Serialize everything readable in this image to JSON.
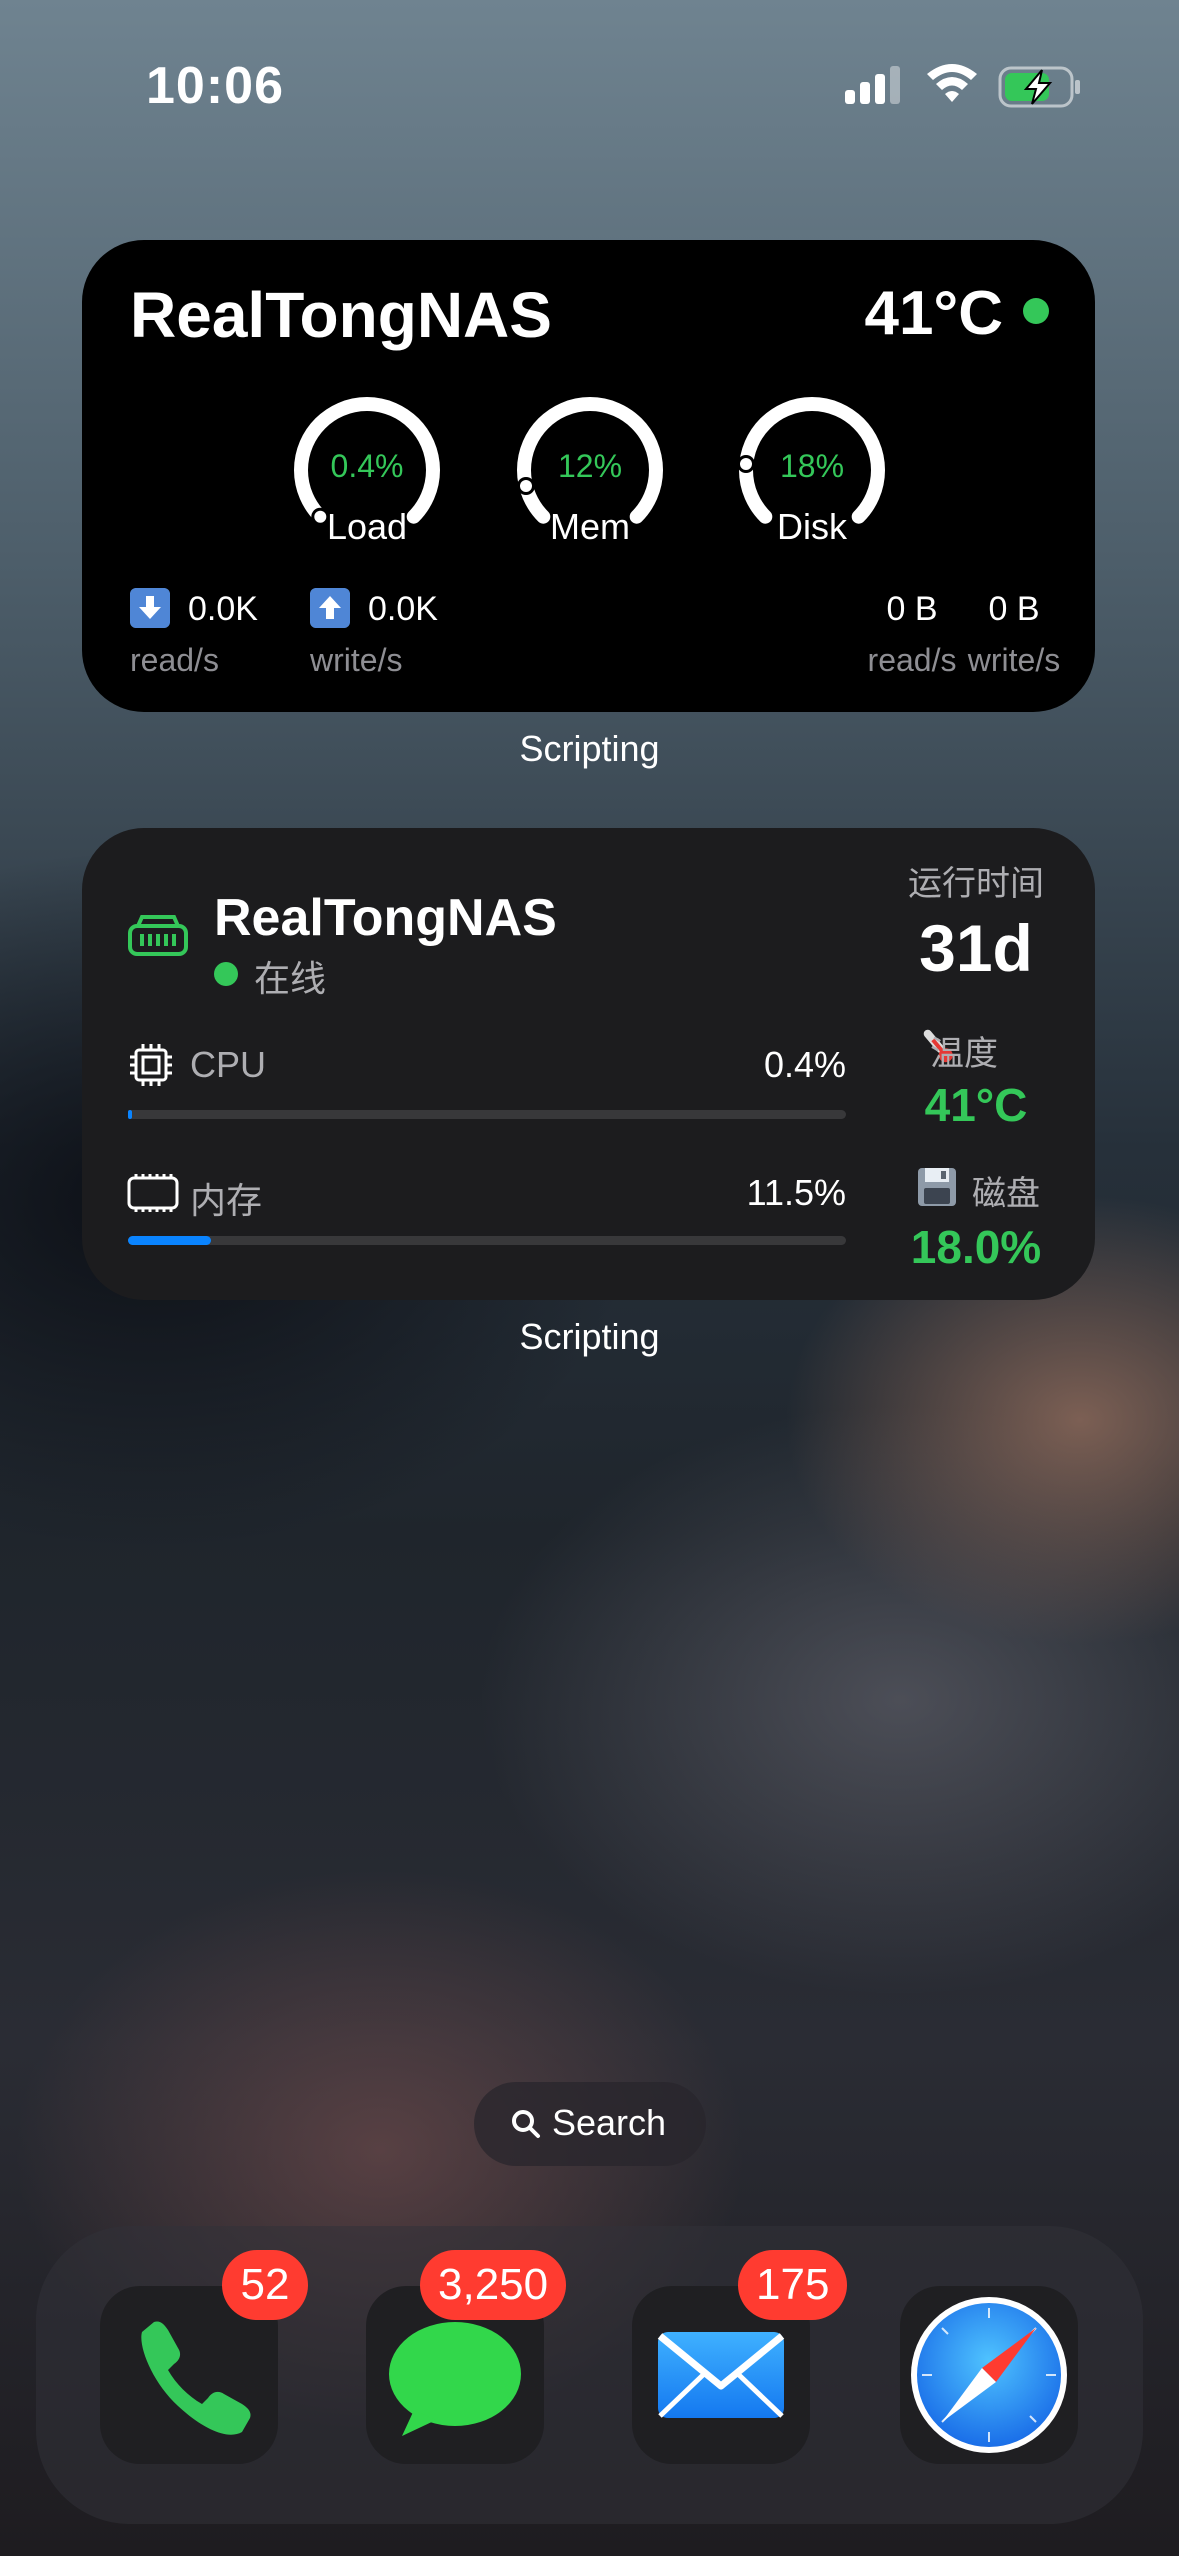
{
  "status_bar": {
    "time": "10:06"
  },
  "nas_widget_compact": {
    "name": "RealTongNAS",
    "temperature": "41°C",
    "gauges": [
      {
        "value": "0.4%",
        "label": "Load",
        "fraction": 0.004
      },
      {
        "value": "12%",
        "label": "Mem",
        "fraction": 0.12
      },
      {
        "value": "18%",
        "label": "Disk",
        "fraction": 0.18
      }
    ],
    "io": [
      {
        "icon": "download-arrow-icon",
        "value": "0.0K",
        "label": "read/s"
      },
      {
        "icon": "upload-arrow-icon",
        "value": "0.0K",
        "label": "write/s"
      },
      {
        "value": "0 B",
        "label": "read/s"
      },
      {
        "value": "0 B",
        "label": "write/s"
      }
    ],
    "caption": "Scripting"
  },
  "nas_widget_detail": {
    "name": "RealTongNAS",
    "status": "在线",
    "cpu": {
      "label": "CPU",
      "value": "0.4%",
      "fraction": 0.004
    },
    "memory": {
      "label": "内存",
      "value": "11.5%",
      "fraction": 0.115
    },
    "uptime_label": "运行时间",
    "uptime": "31d",
    "temp_label": "温度",
    "temp": "41°C",
    "disk_label": "磁盘",
    "disk": "18.0%",
    "caption": "Scripting"
  },
  "search": {
    "label": "Search"
  },
  "dock": [
    {
      "app": "Phone",
      "icon": "phone-icon",
      "badge": "52"
    },
    {
      "app": "Messages",
      "icon": "messages-icon",
      "badge": "3,250"
    },
    {
      "app": "Mail",
      "icon": "mail-icon",
      "badge": "175"
    },
    {
      "app": "Safari",
      "icon": "safari-icon",
      "badge": ""
    }
  ],
  "colors": {
    "green": "#34c759",
    "blue": "#0a84ff",
    "badge_red": "#ff3b30"
  }
}
